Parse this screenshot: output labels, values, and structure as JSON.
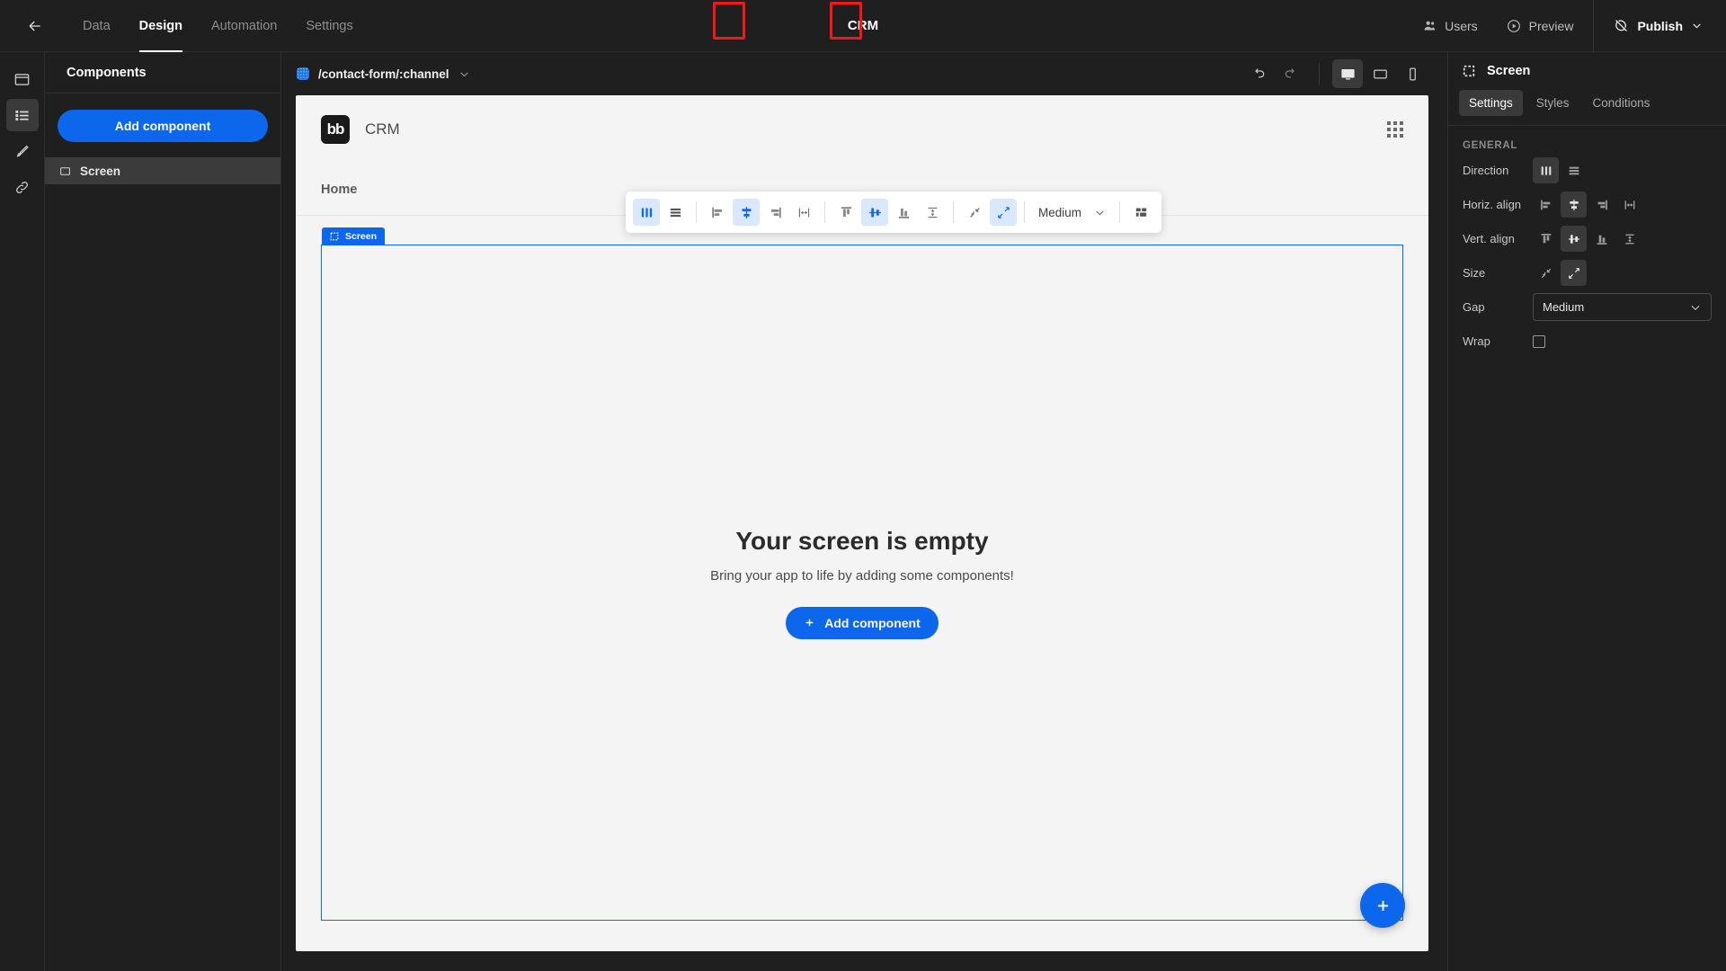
{
  "topbar": {
    "back_icon": "arrow-left-icon",
    "nav": [
      {
        "label": "Data",
        "active": false
      },
      {
        "label": "Design",
        "active": true
      },
      {
        "label": "Automation",
        "active": false
      },
      {
        "label": "Settings",
        "active": false
      }
    ],
    "title": "CRM",
    "users_label": "Users",
    "preview_label": "Preview",
    "publish_label": "Publish"
  },
  "rail": {
    "items": [
      {
        "icon": "screens-icon",
        "active": false
      },
      {
        "icon": "components-list-icon",
        "active": true
      },
      {
        "icon": "theme-brush-icon",
        "active": false
      },
      {
        "icon": "links-chain-icon",
        "active": false
      }
    ]
  },
  "components_panel": {
    "title": "Components",
    "add_button": "Add component",
    "items": [
      {
        "label": "Screen",
        "icon": "screen-icon",
        "selected": true
      }
    ]
  },
  "canvas_bar": {
    "route": "/contact-form/:channel",
    "undo_icon": "undo-icon",
    "redo_icon": "redo-icon",
    "devices": [
      {
        "name": "desktop-icon",
        "active": true
      },
      {
        "name": "tablet-icon",
        "active": false
      },
      {
        "name": "mobile-icon",
        "active": false
      }
    ]
  },
  "preview": {
    "logo_text": "bb",
    "app_name": "CRM",
    "nav_item": "Home",
    "screen_tag": "Screen",
    "empty_title": "Your screen is empty",
    "empty_subtitle": "Bring your app to life by adding some components!",
    "empty_button": "Add component",
    "fab_icon": "plus-icon"
  },
  "align_toolbar": {
    "buttons": [
      {
        "name": "direction-horizontal",
        "icon": "columns-icon",
        "active": true,
        "highlighted": false
      },
      {
        "name": "direction-vertical",
        "icon": "rows-icon",
        "active": false,
        "highlighted": false
      },
      {
        "name": "halign-left",
        "icon": "align-left-icon",
        "active": false,
        "highlighted": false
      },
      {
        "name": "halign-center",
        "icon": "align-center-icon",
        "active": true,
        "highlighted": true
      },
      {
        "name": "halign-right",
        "icon": "align-right-icon",
        "active": false,
        "highlighted": false
      },
      {
        "name": "halign-space",
        "icon": "align-space-between-icon",
        "active": false,
        "highlighted": false
      },
      {
        "name": "valign-top",
        "icon": "valign-top-icon",
        "active": false,
        "highlighted": false
      },
      {
        "name": "valign-middle",
        "icon": "valign-middle-icon",
        "active": true,
        "highlighted": true
      },
      {
        "name": "valign-bottom",
        "icon": "valign-bottom-icon",
        "active": false,
        "highlighted": false
      },
      {
        "name": "valign-space",
        "icon": "valign-space-icon",
        "active": false,
        "highlighted": false
      },
      {
        "name": "size-shrink",
        "icon": "shrink-icon",
        "active": false,
        "highlighted": false
      },
      {
        "name": "size-grow",
        "icon": "grow-icon",
        "active": true,
        "highlighted": false
      }
    ],
    "gap_value": "Medium",
    "grid_icon": "layout-grid-icon"
  },
  "settings_panel": {
    "title": "Screen",
    "tabs": [
      {
        "label": "Settings",
        "active": true
      },
      {
        "label": "Styles",
        "active": false
      },
      {
        "label": "Conditions",
        "active": false
      }
    ],
    "section_title": "GENERAL",
    "rows": {
      "direction_label": "Direction",
      "horiz_align_label": "Horiz. align",
      "vert_align_label": "Vert. align",
      "size_label": "Size",
      "gap_label": "Gap",
      "gap_value": "Medium",
      "wrap_label": "Wrap"
    }
  },
  "colors": {
    "accent": "#0c67ec",
    "highlight": "#f81616",
    "dark_bg": "#1f1f1f",
    "preview_bg": "#f4f4f4"
  }
}
